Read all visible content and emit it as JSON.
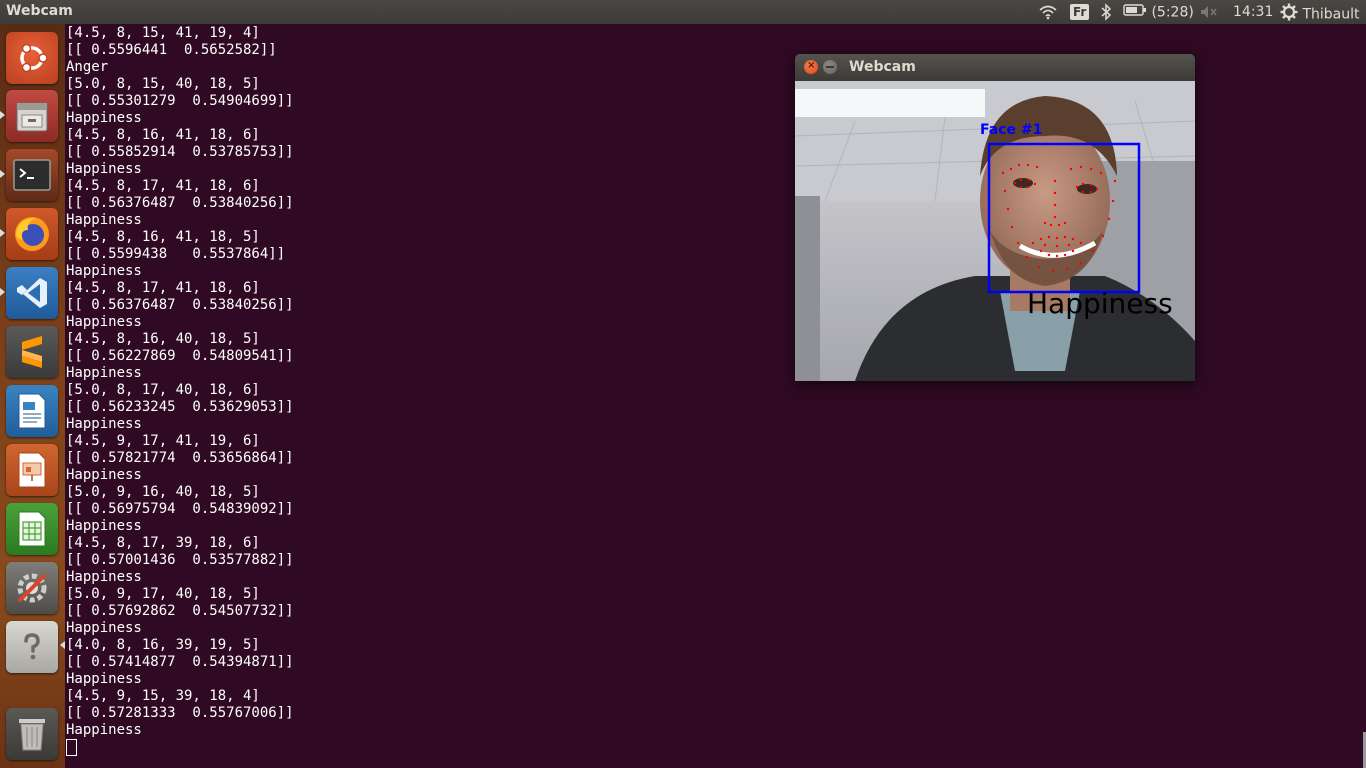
{
  "top_panel": {
    "app_title": "Webcam",
    "keyboard_layout": "Fr",
    "battery_time": "(5:28)",
    "clock": "14:31",
    "user": "Thibault"
  },
  "launcher": {
    "items": [
      {
        "name": "ubuntu-dash"
      },
      {
        "name": "files"
      },
      {
        "name": "terminal"
      },
      {
        "name": "firefox"
      },
      {
        "name": "visual-studio-code"
      },
      {
        "name": "sublime-text"
      },
      {
        "name": "libreoffice-writer"
      },
      {
        "name": "libreoffice-impress"
      },
      {
        "name": "libreoffice-calc"
      },
      {
        "name": "system-settings"
      },
      {
        "name": "help"
      },
      {
        "name": "trash"
      }
    ]
  },
  "terminal": {
    "lines": [
      "[4.5, 8, 15, 41, 19, 4]",
      "[[ 0.5596441  0.5652582]]",
      "Anger",
      "[5.0, 8, 15, 40, 18, 5]",
      "[[ 0.55301279  0.54904699]]",
      "Happiness",
      "[4.5, 8, 16, 41, 18, 6]",
      "[[ 0.55852914  0.53785753]]",
      "Happiness",
      "[4.5, 8, 17, 41, 18, 6]",
      "[[ 0.56376487  0.53840256]]",
      "Happiness",
      "[4.5, 8, 16, 41, 18, 5]",
      "[[ 0.5599438   0.5537864]]",
      "Happiness",
      "[4.5, 8, 17, 41, 18, 6]",
      "[[ 0.56376487  0.53840256]]",
      "Happiness",
      "[4.5, 8, 16, 40, 18, 5]",
      "[[ 0.56227869  0.54809541]]",
      "Happiness",
      "[5.0, 8, 17, 40, 18, 6]",
      "[[ 0.56233245  0.53629053]]",
      "Happiness",
      "[4.5, 9, 17, 41, 19, 6]",
      "[[ 0.57821774  0.53656864]]",
      "Happiness",
      "[5.0, 9, 16, 40, 18, 5]",
      "[[ 0.56975794  0.54839092]]",
      "Happiness",
      "[4.5, 8, 17, 39, 18, 6]",
      "[[ 0.57001436  0.53577882]]",
      "Happiness",
      "[5.0, 9, 17, 40, 18, 5]",
      "[[ 0.57692862  0.54507732]]",
      "Happiness",
      "[4.0, 8, 16, 39, 19, 5]",
      "[[ 0.57414877  0.54394871]]",
      "Happiness",
      "[4.5, 9, 15, 39, 18, 4]",
      "[[ 0.57281333  0.55767006]]",
      "Happiness"
    ]
  },
  "webcam_window": {
    "title": "Webcam",
    "face_label": "Face #1",
    "emotion_label": "Happiness"
  },
  "colors": {
    "terminal_bg": "#300a24",
    "face_box": "#0000ff",
    "landmarks": "#ff0000"
  }
}
